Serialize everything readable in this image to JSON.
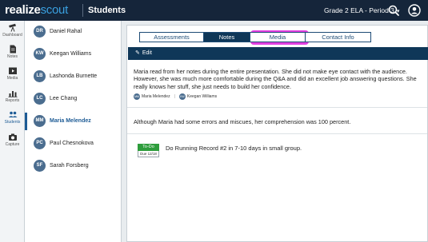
{
  "header": {
    "logo_part1": "realize",
    "logo_part2": "scout",
    "section_title": "Students",
    "class_selector": "Grade 2 ELA - Period 3",
    "search_icon": "search-icon",
    "user_icon": "user-icon"
  },
  "rail": {
    "items": [
      {
        "label": "Dashboard",
        "icon": "telescope-icon"
      },
      {
        "label": "Notes",
        "icon": "document-icon"
      },
      {
        "label": "Media",
        "icon": "media-icon"
      },
      {
        "label": "Reports",
        "icon": "bar-chart-icon"
      },
      {
        "label": "Students",
        "icon": "people-icon"
      },
      {
        "label": "Capture",
        "icon": "camera-icon"
      }
    ]
  },
  "students": [
    {
      "initials": "DR",
      "name": "Daniel Rahal"
    },
    {
      "initials": "KW",
      "name": "Keegan Williams"
    },
    {
      "initials": "LB",
      "name": "Lashonda Burnette"
    },
    {
      "initials": "LC",
      "name": "Lee Chang"
    },
    {
      "initials": "MM",
      "name": "Maria Melendez"
    },
    {
      "initials": "PC",
      "name": "Paul Chesnokova"
    },
    {
      "initials": "SF",
      "name": "Sarah Forsberg"
    }
  ],
  "tabs": {
    "assessments": "Assessments",
    "notes": "Notes",
    "media": "Media",
    "contact": "Contact Info"
  },
  "edit_label": "Edit",
  "notes": {
    "note1": "Maria read from her notes during the entire presentation. She did not make eye contact with the audience. However, she was much more comfortable during the Q&A and did an excellent job answering questions. She really knows her stuff, she just needs to build her confidence.",
    "tag1_initials": "MM",
    "tag1_name": "Maria Melendez",
    "tag2_initials": "KW",
    "tag2_name": "Keegan Williams",
    "note2": "Although Maria had some errors and miscues, her comprehension was 100 percent."
  },
  "todo": {
    "badge": "To-Do",
    "due": "Due 12/18",
    "text": "Do Running Record #2 in 7-10 days in small group."
  },
  "colors": {
    "topbar": "#15253a",
    "accent": "#1d5b95",
    "highlight": "#e23ee0",
    "todo_green": "#2e9d3c"
  }
}
